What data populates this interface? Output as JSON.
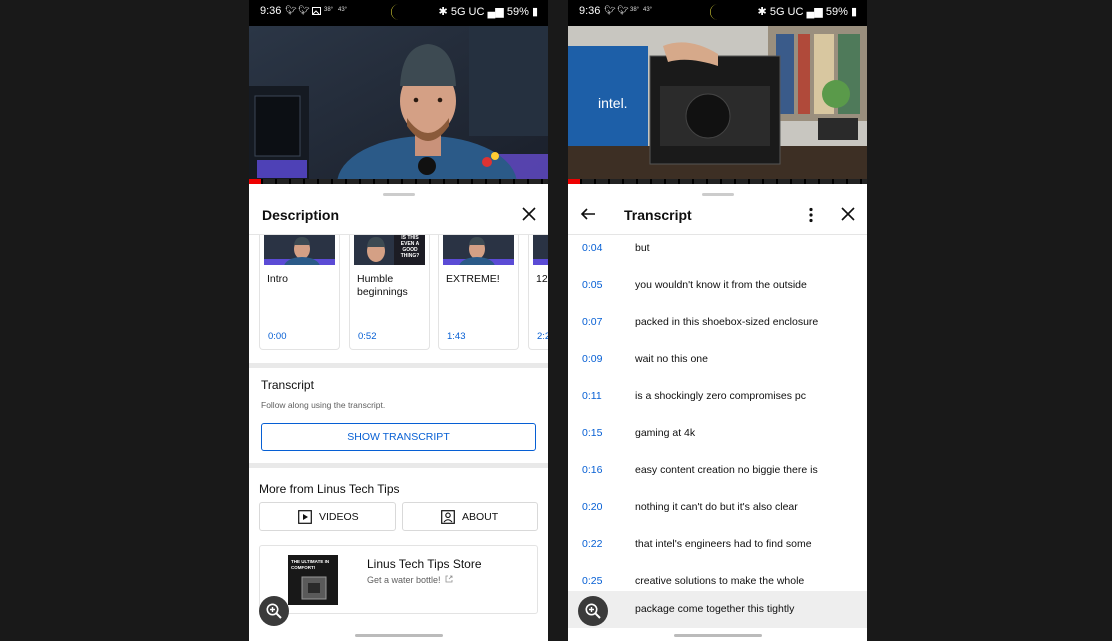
{
  "status_bar": {
    "time": "9:36",
    "temp_left": "38°",
    "temp_right": "43°",
    "network": "5G UC",
    "battery": "59%"
  },
  "left": {
    "sheet_title": "Description",
    "chapters": [
      {
        "title": "Intro",
        "time": "0:00"
      },
      {
        "title": "Humble beginnings",
        "time": "0:52"
      },
      {
        "title": "EXTREME!",
        "time": "1:43"
      },
      {
        "title": "12",
        "time": "2:2"
      }
    ],
    "chapter_thumb_text": "IS THIS EVEN A GOOD THING?",
    "transcript_title": "Transcript",
    "transcript_sub": "Follow along using the transcript.",
    "show_transcript_label": "SHOW TRANSCRIPT",
    "more_from_title": "More from Linus Tech Tips",
    "videos_label": "VIDEOS",
    "about_label": "ABOUT",
    "store_name": "Linus Tech Tips Store",
    "store_sub": "Get a water bottle!",
    "store_thumb_text": "THE ULTIMATE IN COMFORT!"
  },
  "right": {
    "sheet_title": "Transcript",
    "video_brand_text": "intel.",
    "lines": [
      {
        "time": "0:04",
        "text": "but"
      },
      {
        "time": "0:05",
        "text": "you wouldn't know it from the outside"
      },
      {
        "time": "0:07",
        "text": "packed in this shoebox-sized enclosure"
      },
      {
        "time": "0:09",
        "text": "wait no this one"
      },
      {
        "time": "0:11",
        "text": "is a shockingly zero compromises pc"
      },
      {
        "time": "0:15",
        "text": "gaming at 4k"
      },
      {
        "time": "0:16",
        "text": "easy content creation no biggie there is"
      },
      {
        "time": "0:20",
        "text": "nothing it can't do but it's also clear"
      },
      {
        "time": "0:22",
        "text": "that intel's engineers had to find some"
      },
      {
        "time": "0:25",
        "text": "creative solutions to make the whole"
      },
      {
        "time": "",
        "text": "package come together this tightly"
      }
    ]
  },
  "colors": {
    "link_blue": "#065fd4",
    "progress_red": "#ee0000"
  },
  "icons": [
    "twitter-icon",
    "image-icon",
    "moon-icon",
    "bluetooth-icon",
    "signal-icon",
    "battery-icon",
    "close-icon",
    "back-arrow-icon",
    "more-vert-icon",
    "play-square-icon",
    "person-square-icon",
    "external-link-icon",
    "zoom-in-icon"
  ]
}
